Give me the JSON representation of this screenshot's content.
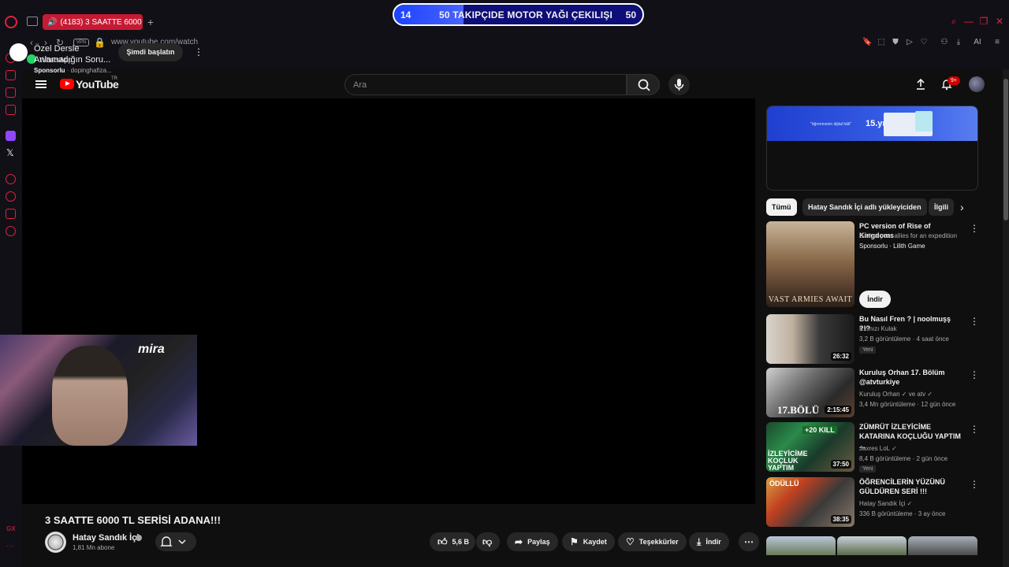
{
  "browser": {
    "tab_title": "(4183) 3 SAATTE 6000",
    "new_tab": "+",
    "url": "www.youtube.com/watch",
    "vpn_label": "VPN",
    "bookmarks": [
      {
        "label": "WhatsApp",
        "icon": "whatsapp-icon"
      }
    ],
    "tools": [
      "bookmark-icon",
      "snapshot-icon",
      "shield-icon",
      "play-icon",
      "heart-icon",
      "account-icon",
      "download-icon",
      "ai-icon",
      "menu-icon"
    ],
    "ai_label": "AI",
    "side_gx": "GX",
    "side_more": "···"
  },
  "promo": {
    "left_number": "14",
    "text": "50 TAKIPÇIDE MOTOR YAĞI ÇEKILIŞI",
    "right_number": "50",
    "progress": 0.28
  },
  "youtube": {
    "logo_text": "YouTube",
    "region": "TR",
    "search_placeholder": "Ara",
    "notif_count": "9+"
  },
  "video": {
    "title": "3 SAATTE 6000 TL SERİSİ ADANA!!!",
    "channel": "Hatay Sandık İçi",
    "subscribers": "1,81 Mn abone",
    "likes": "5,6 B",
    "share": "Paylaş",
    "save": "Kaydet",
    "thanks": "Teşekkürler",
    "download": "İndir",
    "webcam_logo": "mira"
  },
  "ad_card": {
    "banner_text": "\"öğrenmenin dijital hâli\"",
    "banner_years": "15.yıl",
    "title": "Özel Dersle Anlamadığın Soru...",
    "sponsor_label": "Sponsorlu",
    "sponsor_domain": "dopinghafiza...",
    "cta": "Şimdi başlatın"
  },
  "chips": [
    "Tümü",
    "Hatay Sandık İçi adlı yükleyiciden",
    "İlgili"
  ],
  "recommendations": [
    {
      "title": "PC version of Rise of Kingdoms",
      "channel": "Gather your allies for an expedition",
      "meta": "Sponsorlu · Lilith Game",
      "thumb_text": "VAST ARMIES AWAIT",
      "cta": "İndir"
    },
    {
      "title": "Bu Nasıl Fren ? | noolmuşş ?!?",
      "channel": "Kırmızı Kulak",
      "meta": "3,2 B görüntüleme · 4 saat önce",
      "duration": "26:32",
      "badge": "Yeni"
    },
    {
      "title": "Kuruluş Orhan 17. Bölüm @atvturkiye",
      "channel": "Kuruluş Orhan ✓ ve atv ✓",
      "meta": "3,4 Mn görüntüleme · 12 gün önce",
      "duration": "2:15:45",
      "thumb_text": "17.BÖLÜ"
    },
    {
      "title": "ZÜMRÜT İZLEYİCİME KATARINA KOÇLUĞU YAPTIM ...",
      "channel": "Jaxres LoL ✓",
      "meta": "8,4 B görüntüleme · 2 gün önce",
      "duration": "37:50",
      "badge": "Yeni",
      "thumb_text": "İZLEYİCİME KOÇLUK YAPTIM",
      "thumb_badge": "+20 KILL"
    },
    {
      "title": "ÖĞRENCİLERİN YÜZÜNÜ GÜLDÜREN SERİ !!!",
      "channel": "Hatay Sandık İçi ✓",
      "meta": "336 B görüntüleme · 3 ay önce",
      "duration": "38:35",
      "thumb_text": "ÖDÜLLÜ"
    }
  ]
}
